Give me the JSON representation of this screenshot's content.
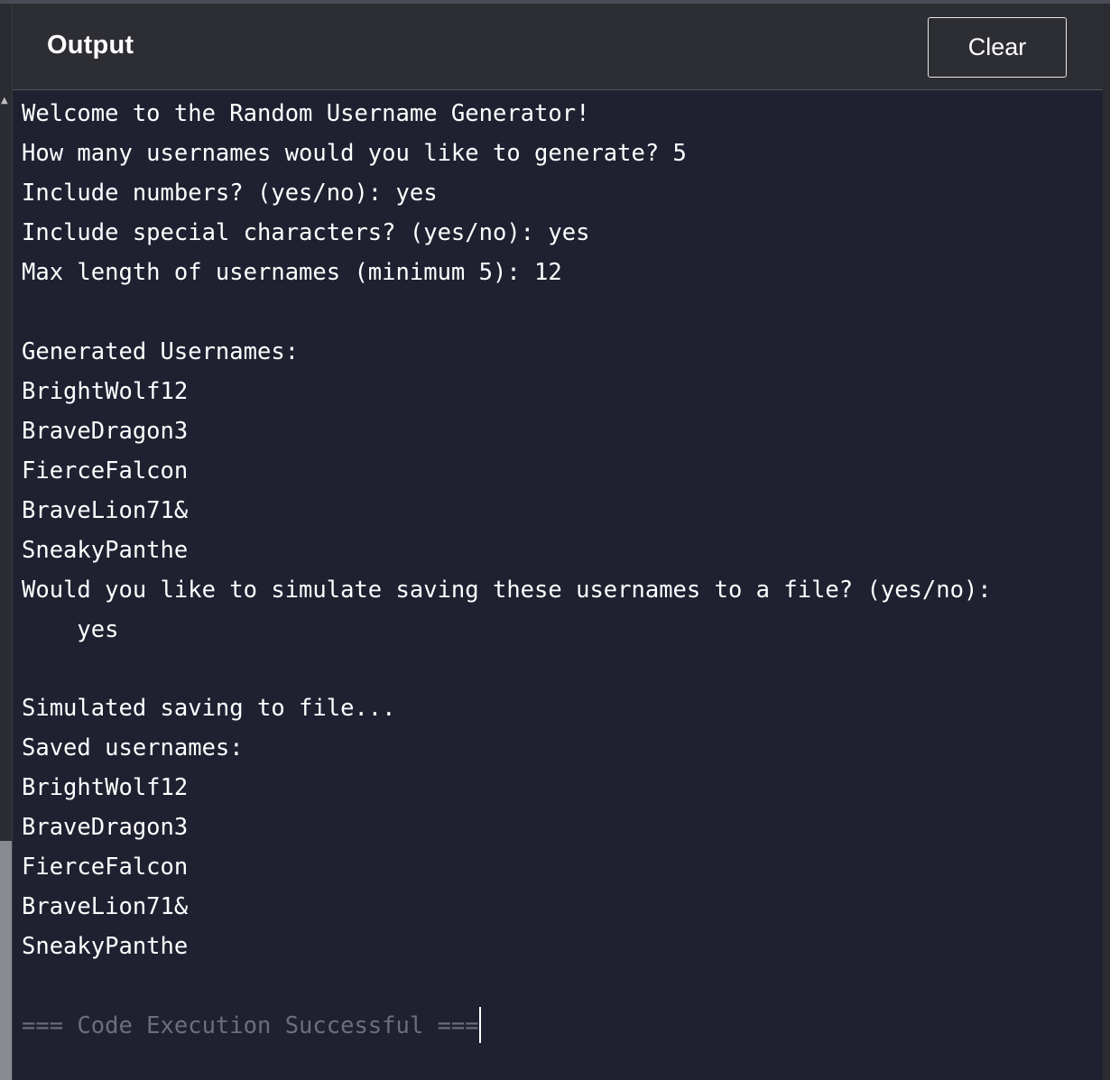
{
  "header": {
    "title": "Output",
    "clear_label": "Clear"
  },
  "console": {
    "lines": [
      "Welcome to the Random Username Generator!",
      "How many usernames would you like to generate? 5",
      "Include numbers? (yes/no): yes",
      "Include special characters? (yes/no): yes",
      "Max length of usernames (minimum 5): 12",
      "",
      "Generated Usernames:",
      "BrightWolf12",
      "BraveDragon3",
      "FierceFalcon",
      "BraveLion71&",
      "SneakyPanthe",
      "Would you like to simulate saving these usernames to a file? (yes/no):",
      "    yes",
      "",
      "Simulated saving to file...",
      "Saved usernames:",
      "BrightWolf12",
      "BraveDragon3",
      "FierceFalcon",
      "BraveLion71&",
      "SneakyPanthe",
      ""
    ],
    "success_message": "=== Code Execution Successful ==="
  },
  "icons": {
    "scroll_up": "scroll-up-arrow-icon"
  },
  "colors": {
    "background": "#1f2131",
    "header": "#2d2e33",
    "text": "#ffffff",
    "muted": "#6d6e78"
  }
}
